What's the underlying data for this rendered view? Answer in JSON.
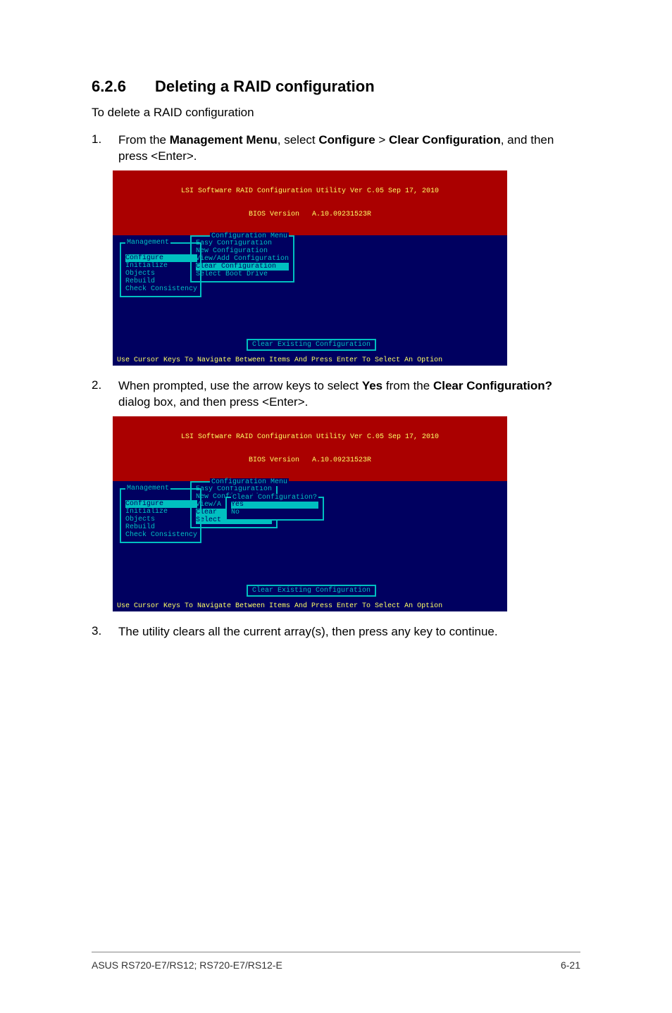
{
  "section": {
    "number": "6.2.6",
    "title": "Deleting a RAID configuration"
  },
  "intro": "To delete a RAID configuration",
  "steps": {
    "s1": {
      "num": "1.",
      "pre": "From the ",
      "b1": "Management Menu",
      "mid1": ", select ",
      "b2": "Configure",
      "mid2": " > ",
      "b3": "Clear Configuration",
      "mid3": ", and then press <Enter>."
    },
    "s2": {
      "num": "2.",
      "pre": "When prompted, use the arrow keys to select ",
      "b1": "Yes",
      "mid1": " from the ",
      "b2": "Clear Configuration?",
      "mid2": " dialog box, and then press <Enter>."
    },
    "s3": {
      "num": "3.",
      "text": "The utility clears all the current array(s), then press any key to continue."
    }
  },
  "bios": {
    "title_line1": "LSI Software RAID Configuration Utility Ver C.05 Sep 17, 2010",
    "title_line2": "BIOS Version   A.10.09231523R",
    "mgmt_label": "Management",
    "mgmt_items": [
      "Configure",
      "Initialize",
      "Objects",
      "Rebuild",
      "Check Consistency"
    ],
    "cfg_label": "Configuration Menu",
    "cfg_items": [
      "Easy Configuration",
      "New Configuration",
      "View/Add Configuration",
      "Clear Configuration",
      "Select Boot Drive"
    ],
    "cfg_stub_items": [
      "View/A",
      "Clear ",
      "Select"
    ],
    "dlg_label": "Clear Configuration?",
    "dlg_items": [
      "Yes",
      "No"
    ],
    "status": "Clear Existing Configuration",
    "footer": "Use Cursor Keys To Navigate Between Items And Press Enter To Select An Option"
  },
  "page_footer": {
    "left": "ASUS RS720-E7/RS12; RS720-E7/RS12-E",
    "right": "6-21"
  }
}
